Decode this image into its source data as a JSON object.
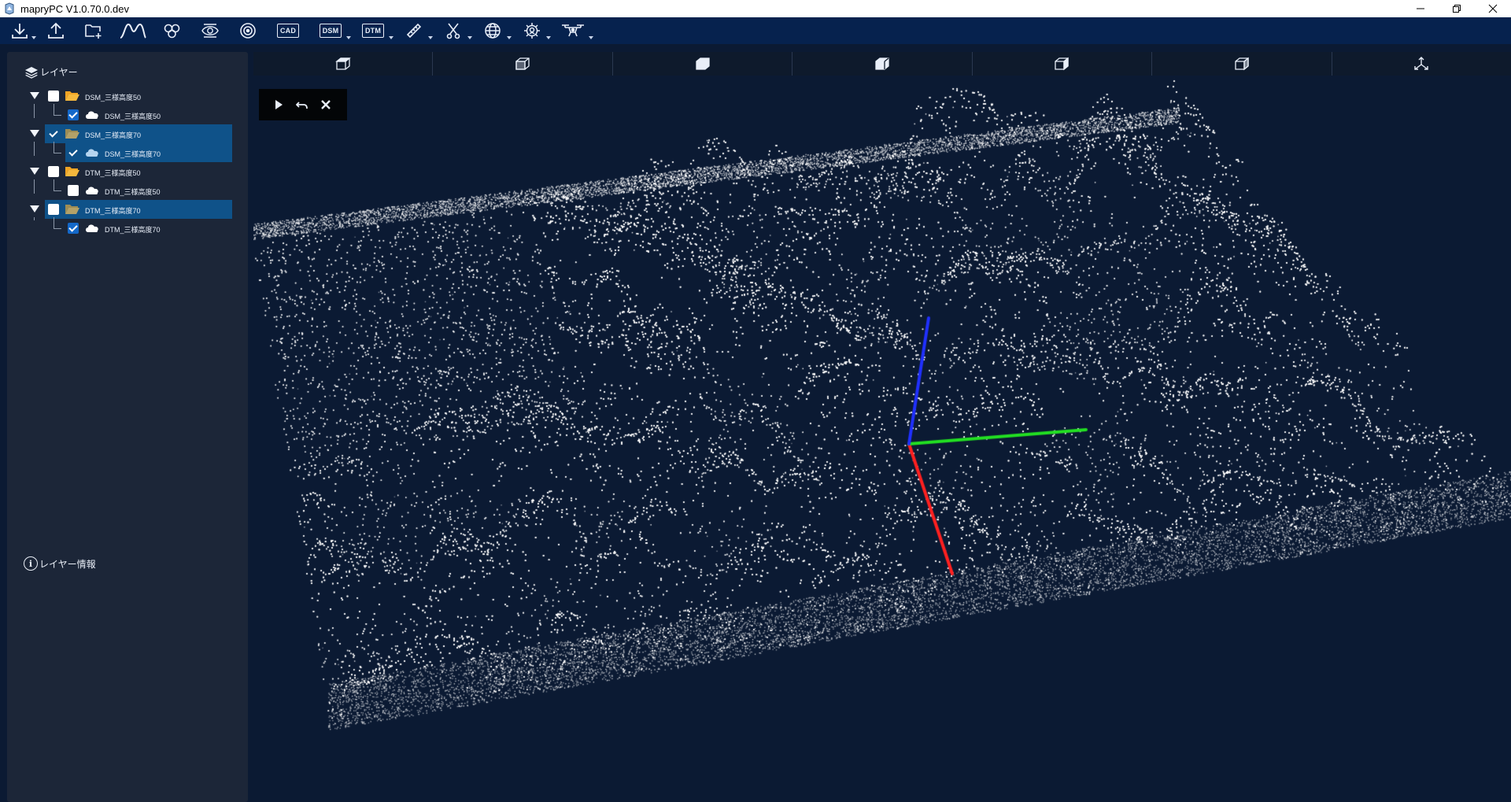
{
  "window": {
    "title": "mapryPC V1.0.70.0.dev"
  },
  "toolbar": {
    "buttons": [
      {
        "icon": "download-icon",
        "dropdown": true
      },
      {
        "icon": "upload-icon",
        "dropdown": false
      },
      {
        "icon": "folder-add-icon",
        "dropdown": false
      },
      {
        "icon": "profile-curve-icon",
        "dropdown": false
      },
      {
        "icon": "tree-cluster-icon",
        "dropdown": false
      },
      {
        "icon": "eye-scan-icon",
        "dropdown": false
      },
      {
        "icon": "target-icon",
        "dropdown": false
      },
      {
        "icon": "cad-icon",
        "label": "CAD",
        "dropdown": false
      },
      {
        "icon": "dsm-icon",
        "label": "DSM",
        "dropdown": true
      },
      {
        "icon": "dtm-icon",
        "label": "DTM",
        "dropdown": true
      },
      {
        "icon": "ruler-icon",
        "dropdown": true
      },
      {
        "icon": "scissors-icon",
        "dropdown": true
      },
      {
        "icon": "globe-icon",
        "dropdown": true
      },
      {
        "icon": "settings-gear-icon",
        "dropdown": true
      },
      {
        "icon": "drone-icon",
        "dropdown": true
      }
    ]
  },
  "left_panel": {
    "layers_title": "レイヤー",
    "layer_info_title": "レイヤー情報",
    "tree": [
      {
        "name": "DSM_三様高度50",
        "type": "folder",
        "checked": false,
        "selected": false,
        "child": {
          "name": "DSM_三様高度50",
          "type": "pointcloud",
          "checked": true,
          "selected": false
        }
      },
      {
        "name": "DSM_三様高度70",
        "type": "folder",
        "checked": true,
        "selected": true,
        "child": {
          "name": "DSM_三様高度70",
          "type": "pointcloud",
          "checked": true,
          "selected": true
        }
      },
      {
        "name": "DTM_三様高度50",
        "type": "folder",
        "checked": false,
        "selected": false,
        "child": {
          "name": "DTM_三様高度50",
          "type": "pointcloud",
          "checked": false,
          "selected": false
        }
      },
      {
        "name": "DTM_三様高度70",
        "type": "folder",
        "checked": false,
        "selected": true,
        "child": {
          "name": "DTM_三様高度70",
          "type": "pointcloud",
          "checked": true,
          "selected": false
        }
      }
    ]
  },
  "view_bar": {
    "views": [
      "view-top-icon",
      "view-front-icon",
      "view-right-icon",
      "view-left-icon",
      "view-back-icon",
      "view-iso-icon",
      "axes-reset-icon"
    ]
  },
  "viewport": {
    "background": "#0b1a33",
    "point_color": "#ffffff",
    "axis_colors": {
      "x": "#ff2020",
      "y": "#22e022",
      "z": "#2030ff"
    }
  },
  "play_controls": [
    "play-icon",
    "undo-icon",
    "close-icon"
  ],
  "colors": {
    "toolbar_bg": "#06224e",
    "panel_bg": "#1c2638",
    "selection_bg": "#0f5289",
    "folder_color": "#f0a424",
    "checkbox_checked": "#1468c9"
  }
}
